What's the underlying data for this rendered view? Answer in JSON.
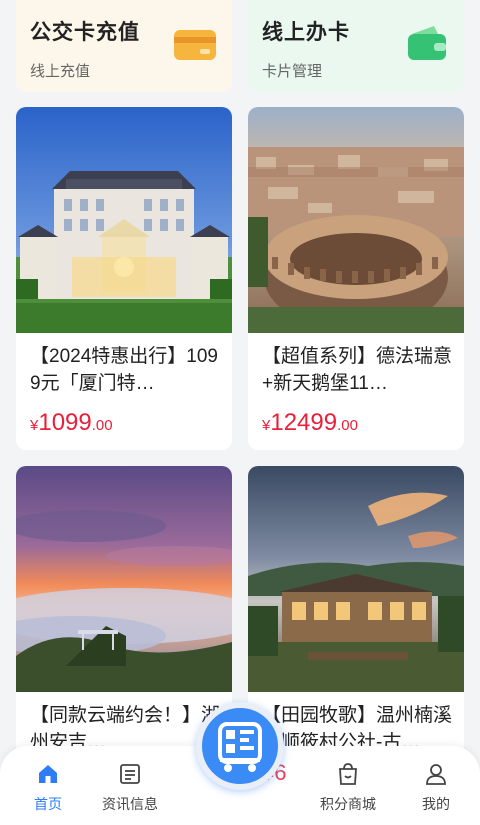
{
  "top_cards": [
    {
      "title": "公交卡充值",
      "subtitle": "线上充值",
      "icon": "card-icon",
      "bg": "#fdf6ea"
    },
    {
      "title": "线上办卡",
      "subtitle": "卡片管理",
      "icon": "wallet-icon",
      "bg": "#eaf8ef"
    }
  ],
  "products": [
    {
      "title": "【2024特惠出行】1099元「厦门特…",
      "currency": "¥",
      "price_int": "1099",
      "price_dec": ".00",
      "image": "palace-hotel-photo"
    },
    {
      "title": "【超值系列】德法瑞意+新天鹅堡11…",
      "currency": "¥",
      "price_int": "12499",
      "price_dec": ".00",
      "image": "colosseum-photo"
    },
    {
      "title": "【同款云端约会！】湖州安吉…",
      "image": "sunset-sea-of-clouds-photo"
    },
    {
      "title": "【田园牧歌】温州楠溪江顺筱村公社-古…",
      "image": "countryside-villa-photo"
    }
  ],
  "partial_price_glyphs": "¥6",
  "tabbar": [
    {
      "label": "首页",
      "icon": "home-icon",
      "active": true
    },
    {
      "label": "资讯信息",
      "icon": "news-icon",
      "active": false
    },
    {
      "label": "积分商城",
      "icon": "shopping-bag-icon",
      "active": false
    },
    {
      "label": "我的",
      "icon": "user-icon",
      "active": false
    }
  ],
  "center_button": {
    "icon": "bus-code-icon"
  },
  "colors": {
    "accent": "#2e7cf6",
    "price": "#e8203a",
    "background": "#f3f4f6"
  }
}
